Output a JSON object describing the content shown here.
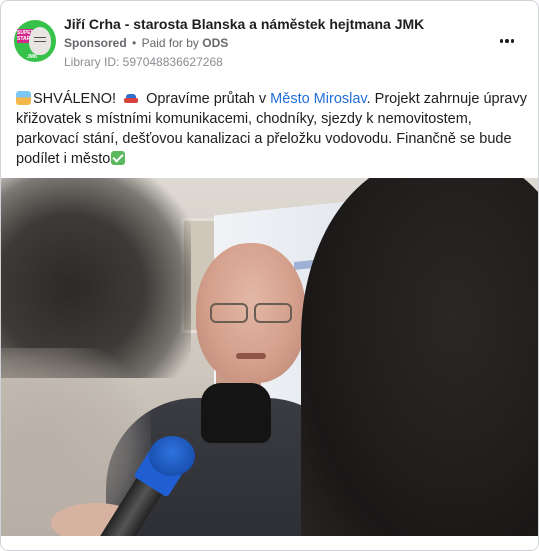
{
  "header": {
    "page_name": "Jiří Crha - starosta Blanska a náměstek hejtmana JMK",
    "sponsored_label": "Sponsored",
    "separator": "•",
    "paid_for_prefix": "Paid for by",
    "paid_for_by": "ODS",
    "library_id": "Library ID: 597048836627268",
    "avatar_badge_text": "SUPER STAROSTA",
    "avatar_footer_text": "JMK"
  },
  "post": {
    "text_part1": "SHVÁLENO!",
    "text_part2": "Opravíme průtah v ",
    "link_text": "Město Miroslav",
    "text_part3": ". Projekt zahrnuje úpravy křižovatek s místními komunikacemi, chodníky, sjezdy k nemovitostem, parkovací stání, dešťovou kanalizaci a přeložku vodovodu. Finančně se bude podílet i město"
  },
  "icons": {
    "more": "more-options-icon",
    "wave": "wave-emoji-icon",
    "car": "car-emoji-icon",
    "check": "check-mark-emoji-icon"
  },
  "colors": {
    "link": "#216fdb",
    "meta": "#65676b",
    "avatar_bg": "#36c24a"
  }
}
